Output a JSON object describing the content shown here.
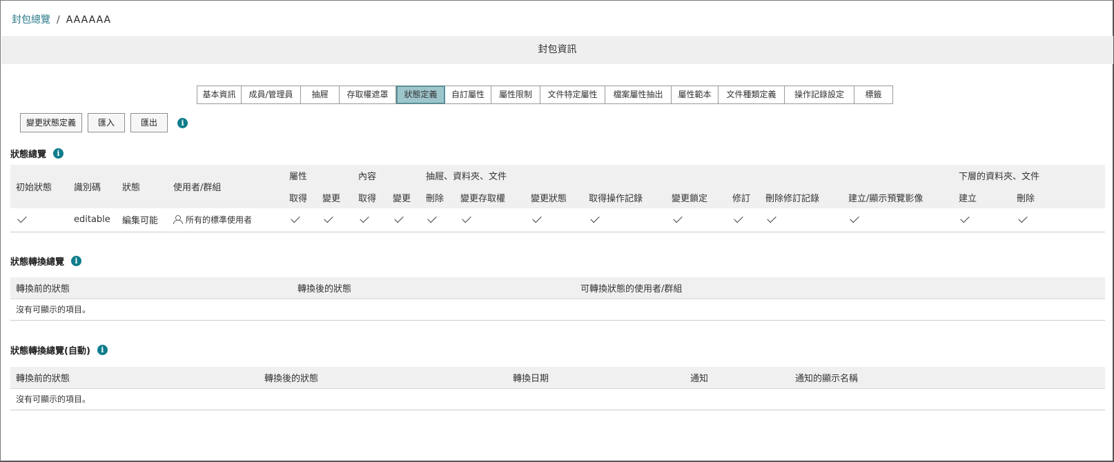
{
  "breadcrumb": {
    "parent": "封包總覽",
    "separator": "/",
    "current": "AAAAAA"
  },
  "info_bar": {
    "title": "封包資訊"
  },
  "tabs": [
    {
      "label": "基本資訊",
      "active": false
    },
    {
      "label": "成員/管理員",
      "active": false
    },
    {
      "label": "抽屜",
      "active": false
    },
    {
      "label": "存取權遮罩",
      "active": false
    },
    {
      "label": "狀態定義",
      "active": true
    },
    {
      "label": "自訂屬性",
      "active": false
    },
    {
      "label": "屬性限制",
      "active": false
    },
    {
      "label": "文件特定屬性",
      "active": false
    },
    {
      "label": "檔案屬性抽出",
      "active": false
    },
    {
      "label": "屬性範本",
      "active": false
    },
    {
      "label": "文件種類定義",
      "active": false
    },
    {
      "label": "操作記錄設定",
      "active": false
    },
    {
      "label": "標籤",
      "active": false
    }
  ],
  "actions": {
    "change_state_def": "變更狀態定義",
    "import": "匯入",
    "export": "匯出"
  },
  "state_overview": {
    "title": "狀態總覽",
    "groups": {
      "attr": "屬性",
      "content": "內容",
      "drawer": "抽屜、資料夾、文件",
      "lower": "下層的資料夾、文件"
    },
    "fixed_headers": {
      "initial": "初始狀態",
      "id": "識別碼",
      "state": "狀態",
      "users": "使用者/群組"
    },
    "sub_headers": [
      "取得",
      "變更",
      "取得",
      "變更",
      "刪除",
      "變更存取權",
      "變更狀態",
      "取得操作記錄",
      "變更鎖定",
      "修訂",
      "刪除修訂記錄",
      "建立/顯示預覽影像",
      "建立",
      "刪除"
    ],
    "rows": [
      {
        "initial": true,
        "id": "editable",
        "state": "編集可能",
        "users": "所有的標準使用者",
        "perms": [
          true,
          true,
          true,
          true,
          true,
          true,
          true,
          true,
          true,
          true,
          true,
          true,
          true,
          true
        ]
      }
    ]
  },
  "transition_overview": {
    "title": "狀態轉換總覽",
    "headers": {
      "from": "轉換前的狀態",
      "to": "轉換後的狀態",
      "users": "可轉換狀態的使用者/群組"
    },
    "empty": "沒有可顯示的項目。"
  },
  "auto_transition_overview": {
    "title": "狀態轉換總覽(自動)",
    "headers": {
      "from": "轉換前的狀態",
      "to": "轉換後的狀態",
      "date": "轉換日期",
      "notify": "通知",
      "notify_name": "通知的顯示名稱"
    },
    "empty": "沒有可顯示的項目。"
  },
  "info_icon_glyph": "i",
  "colors": {
    "accent": "#0e7c8c",
    "active_tab": "#9dc5cc",
    "link": "#2a7a8a",
    "header_bg": "#f0f0f0"
  }
}
